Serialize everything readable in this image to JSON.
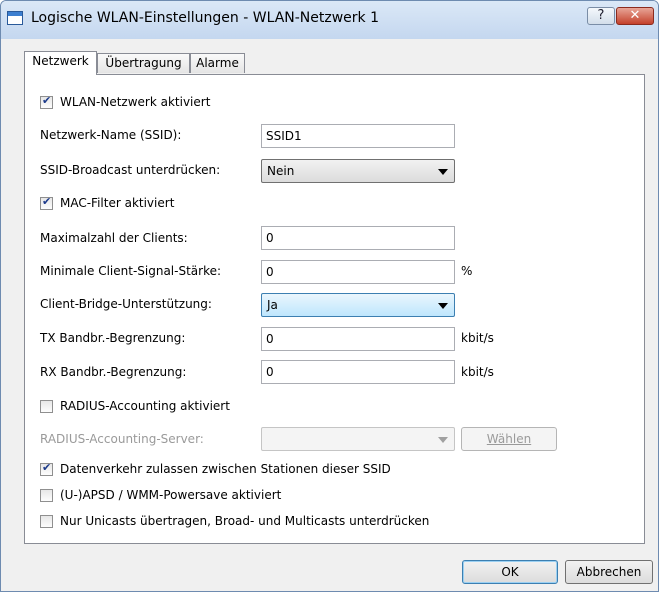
{
  "window": {
    "title": "Logische WLAN-Einstellungen - WLAN-Netzwerk 1",
    "help_glyph": "?",
    "close_glyph": "✕"
  },
  "tabs": [
    {
      "label": "Netzwerk",
      "active": true
    },
    {
      "label": "Übertragung",
      "active": false
    },
    {
      "label": "Alarme",
      "active": false
    }
  ],
  "form": {
    "wlan_enabled": {
      "label": "WLAN-Netzwerk aktiviert",
      "checked": true
    },
    "ssid": {
      "label": "Netzwerk-Name (SSID):",
      "value": "SSID1"
    },
    "ssid_broadcast": {
      "label": "SSID-Broadcast unterdrücken:",
      "value": "Nein"
    },
    "mac_filter": {
      "label": "MAC-Filter aktiviert",
      "checked": true
    },
    "max_clients": {
      "label": "Maximalzahl der Clients:",
      "value": "0"
    },
    "min_signal": {
      "label": "Minimale Client-Signal-Stärke:",
      "value": "0",
      "unit": "%"
    },
    "client_bridge": {
      "label": "Client-Bridge-Unterstützung:",
      "value": "Ja"
    },
    "tx_limit": {
      "label": "TX Bandbr.-Begrenzung:",
      "value": "0",
      "unit": "kbit/s"
    },
    "rx_limit": {
      "label": "RX Bandbr.-Begrenzung:",
      "value": "0",
      "unit": "kbit/s"
    },
    "radius_accounting": {
      "label": "RADIUS-Accounting aktiviert",
      "checked": false
    },
    "radius_server": {
      "label": "RADIUS-Accounting-Server:",
      "value": "",
      "button_label": "Wählen"
    },
    "allow_traffic": {
      "label": "Datenverkehr zulassen zwischen Stationen dieser SSID",
      "checked": true
    },
    "uapsd": {
      "label": "(U-)APSD / WMM-Powersave aktiviert",
      "checked": false
    },
    "unicast_only": {
      "label": "Nur Unicasts übertragen, Broad- und Multicasts unterdrücken",
      "checked": false
    }
  },
  "footer": {
    "ok_label": "OK",
    "cancel_label": "Abbrechen"
  },
  "colors": {
    "accent": "#3c7fb1",
    "title_bar": "#c4d7ef",
    "close_button": "#c4412b"
  }
}
